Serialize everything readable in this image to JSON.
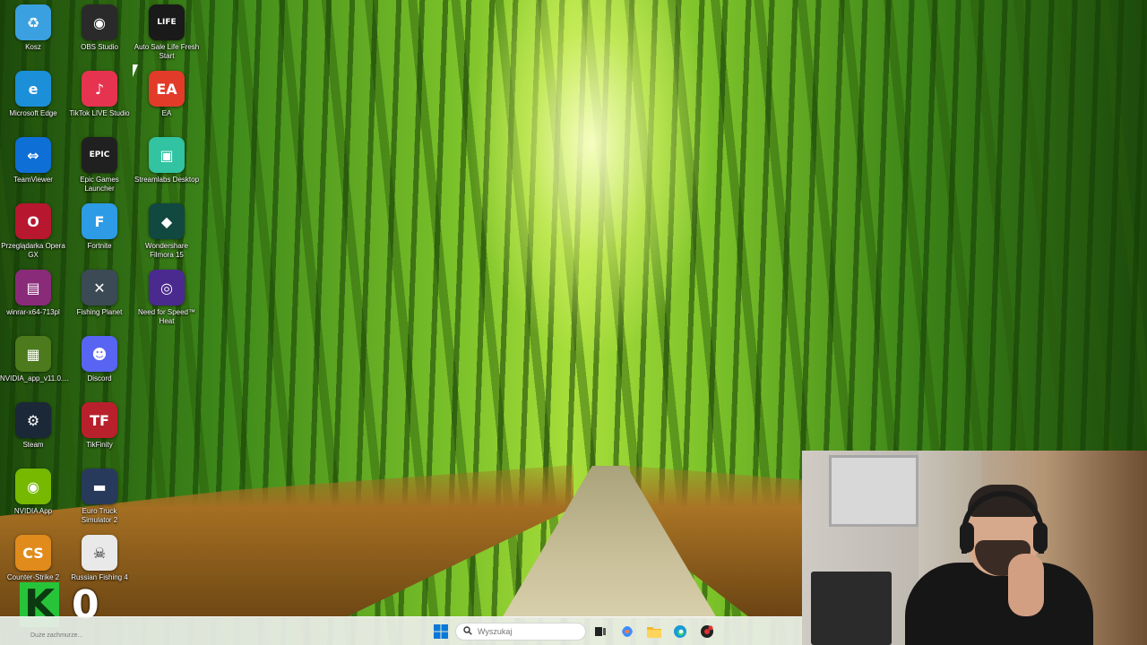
{
  "desktop": {
    "icons": [
      {
        "label": "Kosz",
        "icon": "recycle-bin-icon",
        "color": "#3aa0e0",
        "glyph": "♻"
      },
      {
        "label": "OBS Studio",
        "icon": "obs-icon",
        "color": "#2a2a2a",
        "glyph": "◉"
      },
      {
        "label": "Auto Sale Life Fresh Start",
        "icon": "auto-sale-life-icon",
        "color": "#1a1a1a",
        "glyph": "LIFE"
      },
      {
        "label": "Microsoft Edge",
        "icon": "edge-icon",
        "color": "#1b8fd8",
        "glyph": "e"
      },
      {
        "label": "TikTok LIVE Studio",
        "icon": "tiktok-icon",
        "color": "#e6334f",
        "glyph": "♪"
      },
      {
        "label": "EA",
        "icon": "ea-icon",
        "color": "#e23b2a",
        "glyph": "EA"
      },
      {
        "label": "TeamViewer",
        "icon": "teamviewer-icon",
        "color": "#0e6fd6",
        "glyph": "⇔"
      },
      {
        "label": "Epic Games Launcher",
        "icon": "epic-games-icon",
        "color": "#202020",
        "glyph": "EPIC"
      },
      {
        "label": "Streamlabs Desktop",
        "icon": "streamlabs-icon",
        "color": "#31c3a2",
        "glyph": "▣"
      },
      {
        "label": "Przeglądarka Opera GX",
        "icon": "opera-gx-icon",
        "color": "#b81730",
        "glyph": "O"
      },
      {
        "label": "Fortnite",
        "icon": "fortnite-icon",
        "color": "#2d9be6",
        "glyph": "F"
      },
      {
        "label": "Wondershare Filmora 15",
        "icon": "filmora-icon",
        "color": "#11483f",
        "glyph": "◆"
      },
      {
        "label": "winrar-x64-713pl",
        "icon": "winrar-icon",
        "color": "#8a2b7a",
        "glyph": "▤"
      },
      {
        "label": "Fishing Planet",
        "icon": "fishing-planet-icon",
        "color": "#3b4a55",
        "glyph": "✕"
      },
      {
        "label": "Need for Speed™ Heat",
        "icon": "nfs-heat-icon",
        "color": "#4b2a8f",
        "glyph": "◎"
      },
      {
        "label": "NVIDIA_app_v11.0....",
        "icon": "nvidia-installer-icon",
        "color": "#4c7a1c",
        "glyph": "▦"
      },
      {
        "label": "Discord",
        "icon": "discord-icon",
        "color": "#5865f2",
        "glyph": "☻"
      },
      {
        "label": "Steam",
        "icon": "steam-icon",
        "color": "#1b2838",
        "glyph": "⚙"
      },
      {
        "label": "TikFinity",
        "icon": "tikfinity-icon",
        "color": "#b8202c",
        "glyph": "TF"
      },
      {
        "label": "NVIDIA App",
        "icon": "nvidia-app-icon",
        "color": "#76b900",
        "glyph": "◉"
      },
      {
        "label": "Euro Truck Simulator 2",
        "icon": "ets2-icon",
        "color": "#273a5c",
        "glyph": "▬"
      },
      {
        "label": "Counter-Strike 2",
        "icon": "cs2-icon",
        "color": "#e08b1c",
        "glyph": "CS"
      },
      {
        "label": "Russian Fishing 4",
        "icon": "russian-fishing-icon",
        "color": "#e9e9e9",
        "glyph": "☠"
      }
    ]
  },
  "overlay": {
    "logo_letter": "K",
    "counter": "0"
  },
  "taskbar": {
    "search_placeholder": "Wyszukaj",
    "tray_text": "Duże zachmurze...",
    "apps": [
      {
        "icon": "windows-start-icon"
      },
      {
        "icon": "search-icon"
      },
      {
        "icon": "task-view-icon"
      },
      {
        "icon": "copilot-icon"
      },
      {
        "icon": "file-explorer-icon"
      },
      {
        "icon": "edge-taskbar-icon"
      },
      {
        "icon": "app-taskbar-icon"
      }
    ]
  }
}
